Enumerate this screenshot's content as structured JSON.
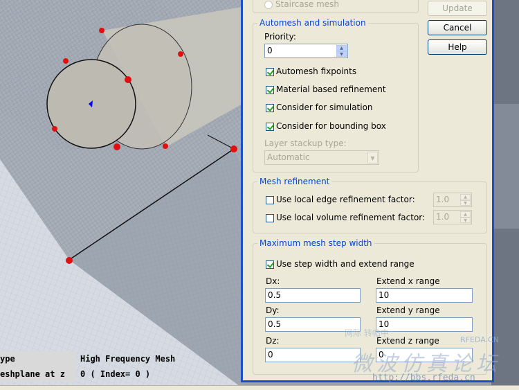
{
  "viewport_info": {
    "type_label": "ype",
    "type_value": "High Frequency Mesh",
    "plane_label": "eshplane at z",
    "plane_value": "0 ( Index= 0 )"
  },
  "dialog": {
    "top_radio": {
      "label": "Staircase mesh"
    },
    "buttons": {
      "update": "Update",
      "cancel": "Cancel",
      "help": "Help"
    },
    "automesh": {
      "title": "Automesh and simulation",
      "priority_label": "Priority:",
      "priority_value": "0",
      "fixpoints_label": "Automesh fixpoints",
      "material_label": "Material based refinement",
      "simulation_label": "Consider for simulation",
      "bounding_label": "Consider for bounding box",
      "layer_label": "Layer stackup type:",
      "layer_value": "Automatic"
    },
    "refinement": {
      "title": "Mesh refinement",
      "edge_label": "Use local edge refinement factor:",
      "edge_value": "1.0",
      "volume_label": "Use local volume refinement factor:",
      "volume_value": "1.0"
    },
    "maxstep": {
      "title": "Maximum mesh step width",
      "use_label": "Use step width and extend range",
      "dx_label": "Dx:",
      "dx_value": "0.5",
      "extx_label": "Extend x range",
      "extx_value": "10",
      "dy_label": "Dy:",
      "dy_value": "0.5",
      "exty_label": "Extend y range",
      "exty_value": "10",
      "dz_label": "Dz:",
      "dz_value": "0",
      "extz_label": "Extend z range",
      "extz_value": "0"
    }
  },
  "watermark": {
    "top": "网际 转帖中",
    "brand": "RFEDA.CN",
    "cn": "微波仿真论坛",
    "url": "http://bbs.rfeda.cn"
  },
  "colors": {
    "accent": "#0046d5",
    "border": "#1c4fc5",
    "point": "#e01010",
    "center": "#0000ff"
  }
}
